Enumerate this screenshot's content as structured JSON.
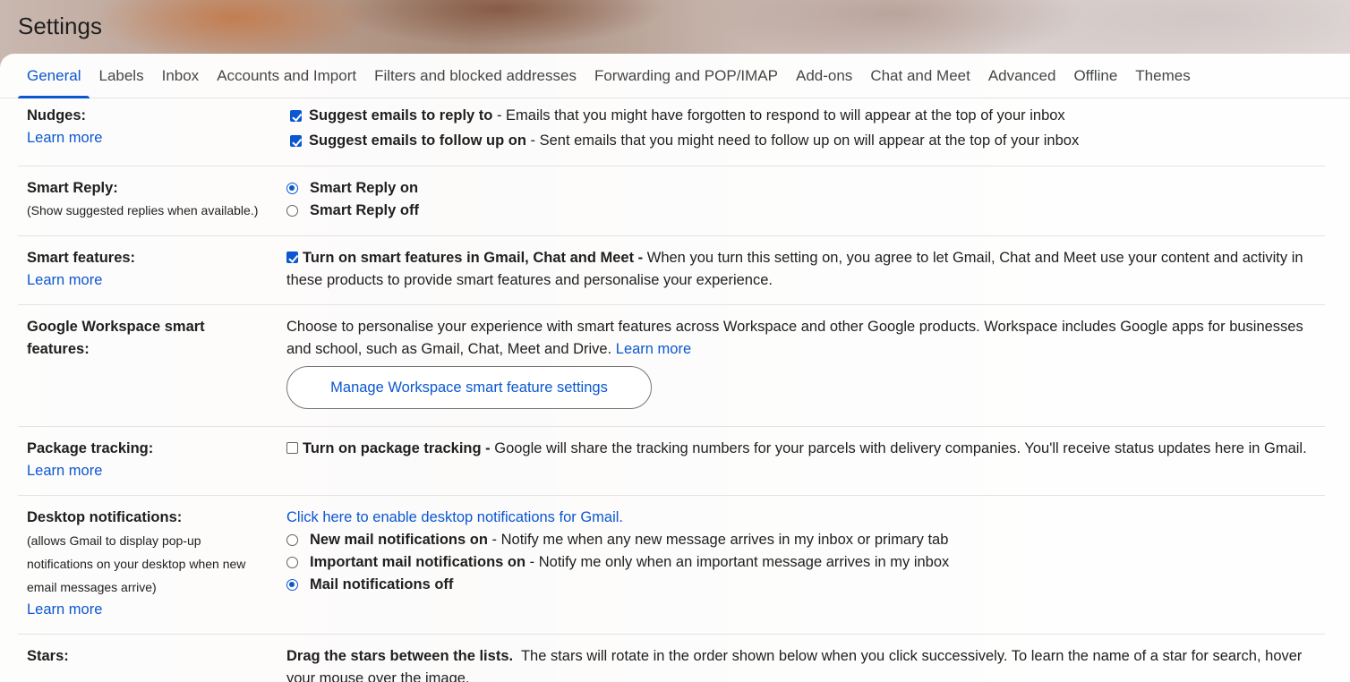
{
  "header": {
    "title": "Settings"
  },
  "tabs": [
    {
      "label": "General",
      "active": true
    },
    {
      "label": "Labels"
    },
    {
      "label": "Inbox"
    },
    {
      "label": "Accounts and Import"
    },
    {
      "label": "Filters and blocked addresses"
    },
    {
      "label": "Forwarding and POP/IMAP"
    },
    {
      "label": "Add-ons"
    },
    {
      "label": "Chat and Meet"
    },
    {
      "label": "Advanced"
    },
    {
      "label": "Offline"
    },
    {
      "label": "Themes"
    }
  ],
  "nudges": {
    "label": "Nudges:",
    "learn_more": "Learn more",
    "options": [
      {
        "checked": true,
        "bold": "Suggest emails to reply to",
        "desc": " - Emails that you might have forgotten to respond to will appear at the top of your inbox"
      },
      {
        "checked": true,
        "bold": "Suggest emails to follow up on",
        "desc": " - Sent emails that you might need to follow up on will appear at the top of your inbox"
      }
    ]
  },
  "smart_reply": {
    "label": "Smart Reply:",
    "sub": "(Show suggested replies when available.)",
    "options": [
      {
        "selected": true,
        "label": "Smart Reply on"
      },
      {
        "selected": false,
        "label": "Smart Reply off"
      }
    ]
  },
  "smart_features": {
    "label": "Smart features:",
    "learn_more": "Learn more",
    "checked": true,
    "bold": "Turn on smart features in Gmail, Chat and Meet -",
    "desc": " When you turn this setting on, you agree to let Gmail, Chat and Meet use your content and activity in these products to provide smart features and personalise your experience."
  },
  "workspace": {
    "label": "Google Workspace smart features:",
    "desc": "Choose to personalise your experience with smart features across Workspace and other Google products. Workspace includes Google apps for businesses and school, such as Gmail, Chat, Meet and Drive. ",
    "learn_more": "Learn more",
    "button": "Manage Workspace smart feature settings"
  },
  "package_tracking": {
    "label": "Package tracking:",
    "learn_more": "Learn more",
    "checked": false,
    "bold": "Turn on package tracking -",
    "desc": " Google will share the tracking numbers for your parcels with delivery companies. You'll receive status updates here in Gmail."
  },
  "desktop_notifications": {
    "label": "Desktop notifications:",
    "sub_lines": [
      "(allows Gmail to display pop-up",
      "notifications on your desktop when new",
      "email messages arrive)"
    ],
    "learn_more": "Learn more",
    "enable_link": "Click here to enable desktop notifications for Gmail.",
    "options": [
      {
        "selected": false,
        "bold": "New mail notifications on",
        "desc": " - Notify me when any new message arrives in my inbox or primary tab"
      },
      {
        "selected": false,
        "bold": "Important mail notifications on",
        "desc": " - Notify me only when an important message arrives in my inbox"
      },
      {
        "selected": true,
        "bold": "Mail notifications off",
        "desc": ""
      }
    ]
  },
  "stars": {
    "label": "Stars:",
    "bold": "Drag the stars between the lists.",
    "desc": "  The stars will rotate in the order shown below when you click successively. To learn the name of a star for search, hover your mouse over the image."
  },
  "colors": {
    "accent": "#0b57d0",
    "text": "#1f1f1f",
    "divider": "#e3e3e3"
  }
}
